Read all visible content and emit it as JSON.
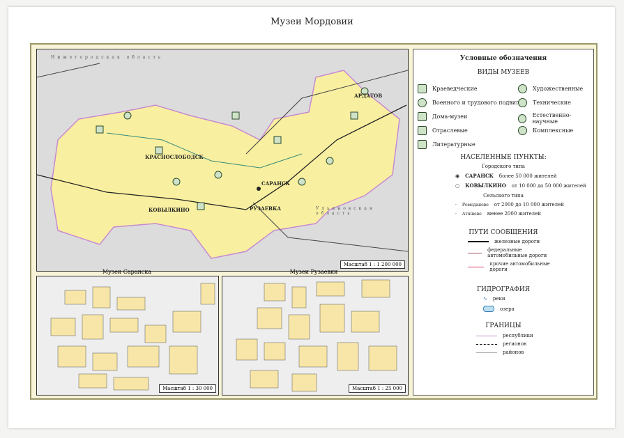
{
  "title": "Музеи Мордовии",
  "main_map": {
    "scale": "Масштаб 1 : 1 200 000",
    "cities": [
      "САРАНСК",
      "РУЗАЕВКА",
      "КОВЫЛКИНО",
      "КРАСНОСЛОБОДСК",
      "АРДАТОВ"
    ],
    "neighbors": [
      "Нижегородская область",
      "Ульяновская область"
    ]
  },
  "insets": [
    {
      "title": "Музеи Саранска",
      "scale": "Масштаб 1 : 30 000"
    },
    {
      "title": "Музеи Рузаевки",
      "scale": "Масштаб 1 : 25 000"
    }
  ],
  "legend": {
    "heading": "Условные обозначения",
    "museum_types_heading": "ВИДЫ МУЗЕЕВ",
    "museum_types": [
      "Краеведческие",
      "Военного и трудового подвига",
      "Дома-музеи",
      "Отраслевые",
      "Литературные",
      "Художественные",
      "Технические",
      "Естественно-научные",
      "Комплексные"
    ],
    "settlements_heading": "НАСЕЛЕННЫЕ ПУНКТЫ:",
    "urban": "Городского типа",
    "urban_rows": [
      {
        "sample": "САРАНСК",
        "text": "более 50 000 жителей"
      },
      {
        "sample": "КОВЫЛКИНО",
        "text": "от 10 000 до 50 000 жителей"
      }
    ],
    "rural": "Сельского типа",
    "rural_rows": [
      {
        "sample": "Ромоданово",
        "text": "от 2000 до 10 000 жителей"
      },
      {
        "sample": "Атяшево",
        "text": "менее 2000 жителей"
      }
    ],
    "roads_heading": "ПУТИ СООБЩЕНИЯ",
    "roads": [
      "железные дороги",
      "федеральные автомобильные дороги",
      "прочие автомобильные дороги"
    ],
    "hydro_heading": "ГИДРОГРАФИЯ",
    "hydro": [
      "реки",
      "озера"
    ],
    "borders_heading": "ГРАНИЦЫ",
    "borders": [
      "республики",
      "регионов",
      "районов"
    ]
  },
  "colors": {
    "region": "#f8f0a0",
    "outside": "#dcdcdc",
    "icon": "#2b4a2b",
    "frame": "#9a9868"
  }
}
